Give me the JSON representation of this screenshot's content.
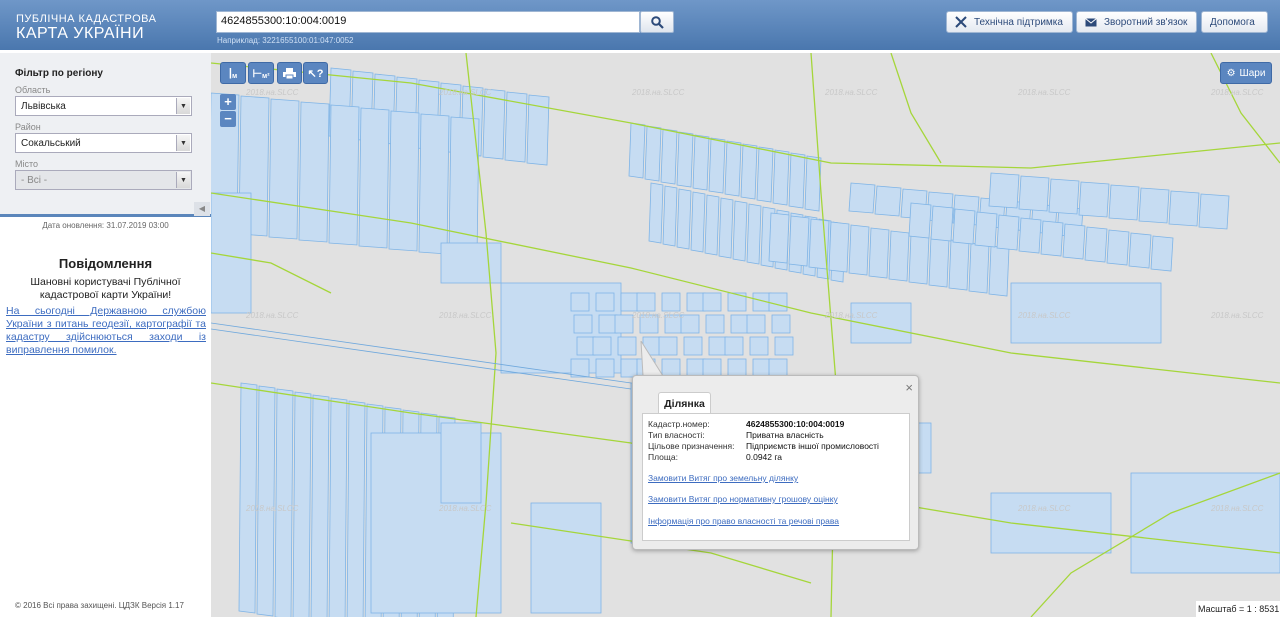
{
  "header": {
    "logo_line1": "ПУБЛІЧНА КАДАСТРОВА",
    "logo_line2": "КАРТА УКРАЇНИ",
    "search_value": "4624855300:10:004:0019",
    "search_hint": "Наприклад: 3221655100:01:047:0052",
    "support_label": "Технічна підтримка",
    "feedback_label": "Зворотний зв'язок",
    "help_label": "Допомога",
    "search_icon": "search-icon",
    "support_icon": "tools-icon",
    "feedback_icon": "envelope-icon"
  },
  "sidebar": {
    "filter_title": "Фільтр по регіону",
    "region_label": "Область",
    "region_value": "Львівська",
    "district_label": "Район",
    "district_value": "Сокальський",
    "city_label": "Місто",
    "city_value": "- Всі -",
    "update_date": "Дата оновлення: 31.07.2019 03:00",
    "notice_title": "Повідомлення",
    "notice_text": "Шановні користувачі Публічної кадастрової карти України!",
    "notice_link": "На сьогодні Державною службою України з питань геодезії, картографії та кадастру здійснюються заходи із виправлення помилок.",
    "copyright": "© 2016 Всі права захищені. ЦДЗК Версія 1.17"
  },
  "map": {
    "tool_measure_length": "м",
    "tool_measure_area": "м²",
    "zoom_in": "+",
    "zoom_out": "−",
    "layers_label": "Шари",
    "watermark": "2018.на.SLCC",
    "scale": "Масштаб = 1 : 8531",
    "colors": {
      "parcel_fill": "#c6dcf2",
      "parcel_stroke": "#7fb4e6",
      "boundary": "#a5d63a",
      "map_bg": "#e1e1e1"
    }
  },
  "popup": {
    "tab": "Ділянка",
    "close": "×",
    "cadastral_label": "Кадастр.номер:",
    "cadastral_value": "4624855300:10:004:0019",
    "ownership_label": "Тип власності:",
    "ownership_value": "Приватна власність",
    "purpose_label": "Цільове призначення:",
    "purpose_value": "Підприємств іншої промисловості",
    "area_label": "Площа:",
    "area_value": "0.0942 га",
    "link1": "Замовити Витяг про земельну ділянку",
    "link2": "Замовити Витяг про нормативну грошову оцінку",
    "link3": "Інформація про право власності та речові права"
  }
}
